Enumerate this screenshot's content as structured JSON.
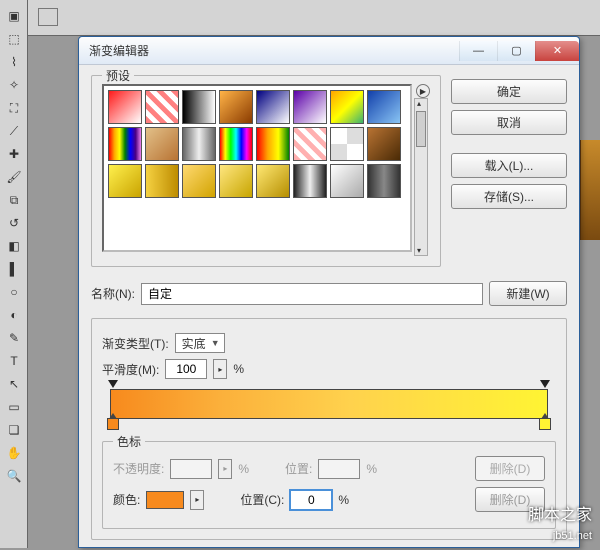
{
  "dialog": {
    "title": "渐变编辑器",
    "ok": "确定",
    "cancel": "取消",
    "load": "载入(L)...",
    "save": "存储(S)...",
    "new": "新建(W)"
  },
  "presets": {
    "legend": "预设"
  },
  "name": {
    "label": "名称(N):",
    "value": "自定"
  },
  "gradientType": {
    "label": "渐变类型(T):",
    "value": "实底"
  },
  "smoothness": {
    "label": "平滑度(M):",
    "value": "100",
    "unit": "%"
  },
  "stops": {
    "legend": "色标",
    "opacity_label": "不透明度:",
    "opacity_unit": "%",
    "position_label": "位置:",
    "position_unit": "%",
    "color_label": "颜色:",
    "color_position_label": "位置(C):",
    "color_position_value": "0",
    "delete": "删除(D)",
    "color_chip": "#f78a1d"
  },
  "swatches": [
    "linear-gradient(135deg,#ff1a1a,#fff)",
    "repeating-linear-gradient(45deg,#ff8080 0 5px,#fff 5px 10px)",
    "linear-gradient(90deg,#000,#fff)",
    "linear-gradient(135deg,#ffb347,#8a3b00)",
    "linear-gradient(135deg,#000080,#fff)",
    "linear-gradient(135deg,#5b00a8,#fff)",
    "linear-gradient(135deg,#ffa500,#ffff00,#3cb371)",
    "linear-gradient(135deg,#1240ab,#89c4f4)",
    "linear-gradient(90deg,red,orange,yellow,green,blue,indigo,violet)",
    "linear-gradient(135deg,#e2c089,#b87333)",
    "linear-gradient(90deg,#666,#eee,#666)",
    "linear-gradient(90deg,red,yellow,lime,cyan,blue,magenta,red)",
    "linear-gradient(90deg,red,orange,yellow,green)",
    "repeating-linear-gradient(45deg,#ffb0b0 0 5px,#fff 5px 10px)",
    "repeating-conic-gradient(#ddd 0 25%,#fff 0 50%)",
    "linear-gradient(135deg,#b87333,#4a2a05)",
    "linear-gradient(135deg,#fff04d,#c9a300)",
    "linear-gradient(90deg,#f5d142,#bd8c00)",
    "linear-gradient(135deg,#ffd970,#d1a300)",
    "linear-gradient(135deg,#ffe680,#c7a500)",
    "linear-gradient(135deg,#ffe873,#b58e00)",
    "linear-gradient(90deg,#222,#eee,#222)",
    "linear-gradient(135deg,#fff,#aaa)",
    "linear-gradient(90deg,#333,#888,#333)"
  ],
  "watermark": {
    "line1": "脚本之家",
    "line2": "jb51.net"
  }
}
